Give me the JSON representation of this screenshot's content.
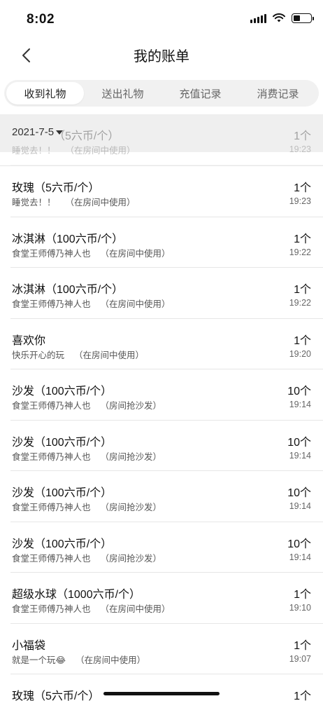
{
  "status_bar": {
    "time": "8:02"
  },
  "nav": {
    "title": "我的账单"
  },
  "tabs": [
    {
      "label": "收到礼物",
      "active": true
    },
    {
      "label": "送出礼物",
      "active": false
    },
    {
      "label": "充值记录",
      "active": false
    },
    {
      "label": "消费记录",
      "active": false
    }
  ],
  "date_filter": {
    "value": "2021-7-5"
  },
  "ghost_row": {
    "name": "（5六币/个）",
    "desc": "睡觉去！！",
    "note": "（在房间中使用）",
    "count": "1个",
    "time": "19:23"
  },
  "records": [
    {
      "name": "玫瑰（5六币/个）",
      "desc": "睡觉去！！",
      "note": "（在房间中使用）",
      "count": "1个",
      "time": "19:23"
    },
    {
      "name": "冰淇淋（100六币/个）",
      "desc": "食堂王师傅乃神人也",
      "note": "（在房间中使用）",
      "count": "1个",
      "time": "19:22"
    },
    {
      "name": "冰淇淋（100六币/个）",
      "desc": "食堂王师傅乃神人也",
      "note": "（在房间中使用）",
      "count": "1个",
      "time": "19:22"
    },
    {
      "name": "喜欢你",
      "desc": "快乐开心的玩",
      "note": "（在房间中使用）",
      "count": "1个",
      "time": "19:20"
    },
    {
      "name": "沙发（100六币/个）",
      "desc": "食堂王师傅乃神人也",
      "note": "（房间抢沙发）",
      "count": "10个",
      "time": "19:14"
    },
    {
      "name": "沙发（100六币/个）",
      "desc": "食堂王师傅乃神人也",
      "note": "（房间抢沙发）",
      "count": "10个",
      "time": "19:14"
    },
    {
      "name": "沙发（100六币/个）",
      "desc": "食堂王师傅乃神人也",
      "note": "（房间抢沙发）",
      "count": "10个",
      "time": "19:14"
    },
    {
      "name": "沙发（100六币/个）",
      "desc": "食堂王师傅乃神人也",
      "note": "（房间抢沙发）",
      "count": "10个",
      "time": "19:14"
    },
    {
      "name": "超级水球（1000六币/个）",
      "desc": "食堂王师傅乃神人也",
      "note": "（在房间中使用）",
      "count": "1个",
      "time": "19:10"
    },
    {
      "name": "小福袋",
      "desc": "就是一个玩😂",
      "note": "（在房间中使用）",
      "count": "1个",
      "time": "19:07"
    },
    {
      "name": "玫瑰（5六币/个）",
      "desc": "",
      "note": "",
      "count": "1个",
      "time": ""
    }
  ],
  "icons": {
    "back": "chevron-left-icon",
    "signal": "signal-icon",
    "wifi": "wifi-icon",
    "battery": "battery-icon",
    "date_caret": "caret-down-icon"
  },
  "colors": {
    "tab_bg": "#f1f1f1",
    "header_bg": "#eeeeee",
    "divider": "#e6e6e6"
  },
  "battery_level": 0.4
}
